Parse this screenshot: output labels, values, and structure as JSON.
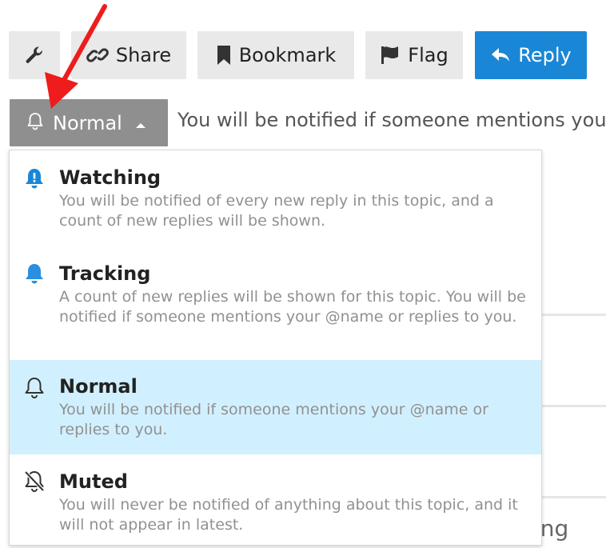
{
  "toolbar": {
    "share_label": "Share",
    "bookmark_label": "Bookmark",
    "flag_label": "Flag",
    "reply_label": "Reply"
  },
  "notifications": {
    "button_label": "Normal",
    "description": "You will be notified if someone mentions your"
  },
  "dropdown": {
    "options": [
      {
        "title": "Watching",
        "description": "You will be notified of every new reply in this topic, and a count of new replies will be shown.",
        "icon": "bell-exclamation-icon",
        "selected": false
      },
      {
        "title": "Tracking",
        "description": "A count of new replies will be shown for this topic. You will be notified if someone mentions your @name or replies to you.",
        "icon": "bell-filled-icon",
        "selected": false
      },
      {
        "title": "Normal",
        "description": "You will be notified if someone mentions your @name or replies to you.",
        "icon": "bell-outline-icon",
        "selected": true
      },
      {
        "title": "Muted",
        "description": "You will never be notified of anything about this topic, and it will not appear in latest.",
        "icon": "bell-slash-icon",
        "selected": false
      }
    ]
  },
  "background": {
    "partial_text": "ing"
  },
  "colors": {
    "reply_blue": "#1a87d6",
    "notif_button_gray": "#8f8f8f",
    "watching_icon_blue": "#1a87d6",
    "tracking_icon_blue": "#2a8fe0",
    "selected_row": "#d1f0ff",
    "arrow_red": "#ee1c1c"
  }
}
